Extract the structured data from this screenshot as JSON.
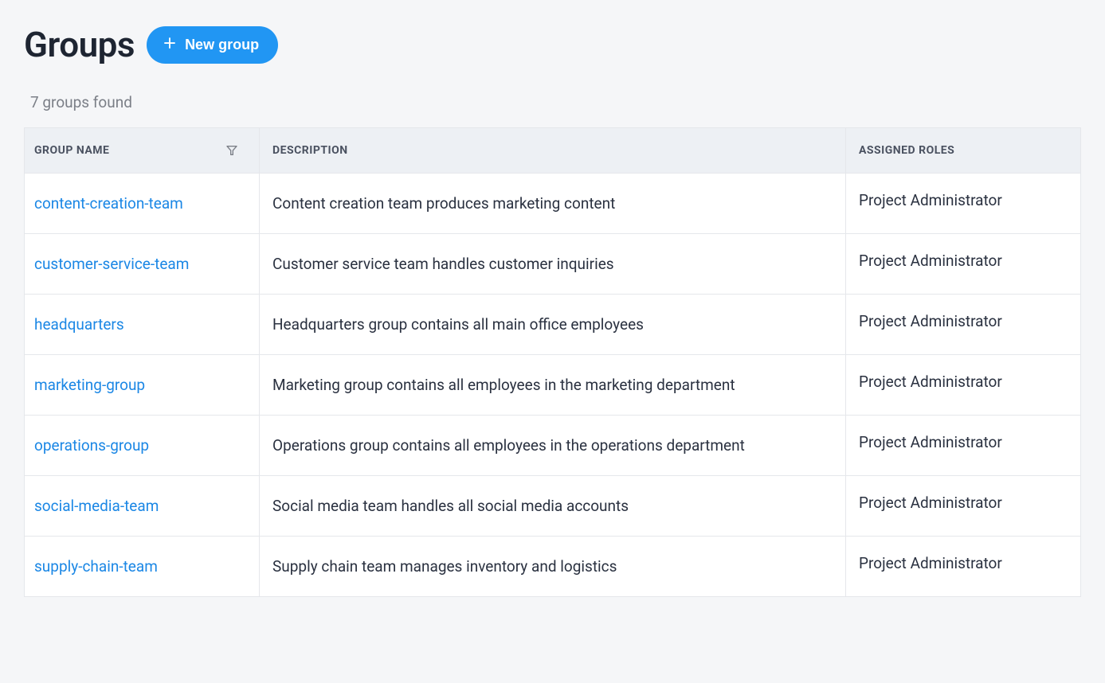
{
  "header": {
    "title": "Groups",
    "new_group_label": "New group"
  },
  "summary": {
    "count_text": "7 groups found"
  },
  "table": {
    "columns": {
      "name": "GROUP NAME",
      "description": "DESCRIPTION",
      "roles": "ASSIGNED ROLES"
    },
    "rows": [
      {
        "name": "content-creation-team",
        "description": "Content creation team produces marketing content",
        "roles": "Project Administrator"
      },
      {
        "name": "customer-service-team",
        "description": "Customer service team handles customer inquiries",
        "roles": "Project Administrator"
      },
      {
        "name": "headquarters",
        "description": "Headquarters group contains all main office employees",
        "roles": "Project Administrator"
      },
      {
        "name": "marketing-group",
        "description": "Marketing group contains all employees in the marketing department",
        "roles": "Project Administrator"
      },
      {
        "name": "operations-group",
        "description": "Operations group contains all employees in the operations department",
        "roles": "Project Administrator"
      },
      {
        "name": "social-media-team",
        "description": "Social media team handles all social media accounts",
        "roles": "Project Administrator"
      },
      {
        "name": "supply-chain-team",
        "description": "Supply chain team manages inventory and logistics",
        "roles": "Project Administrator"
      }
    ]
  }
}
